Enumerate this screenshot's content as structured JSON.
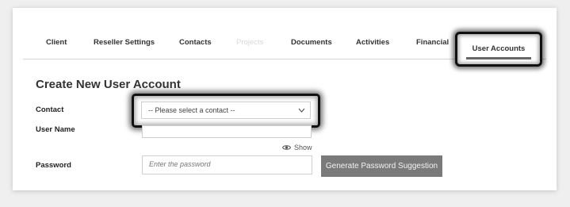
{
  "tabs": [
    {
      "label": "Client"
    },
    {
      "label": "Reseller Settings"
    },
    {
      "label": "Contacts"
    },
    {
      "label": "Projects"
    },
    {
      "label": "Documents"
    },
    {
      "label": "Activities"
    },
    {
      "label": "Financial"
    },
    {
      "label": "User Accounts"
    }
  ],
  "form": {
    "title": "Create New User Account",
    "contact_label": "Contact",
    "contact_placeholder": "-- Please select a contact --",
    "username_label": "User Name",
    "username_value": "",
    "show_label": "Show",
    "password_label": "Password",
    "password_placeholder": "Enter the password",
    "generate_button": "Generate Password Suggestion"
  },
  "icons": {
    "dropdown": "chevron-down-icon",
    "show": "eye-icon"
  }
}
